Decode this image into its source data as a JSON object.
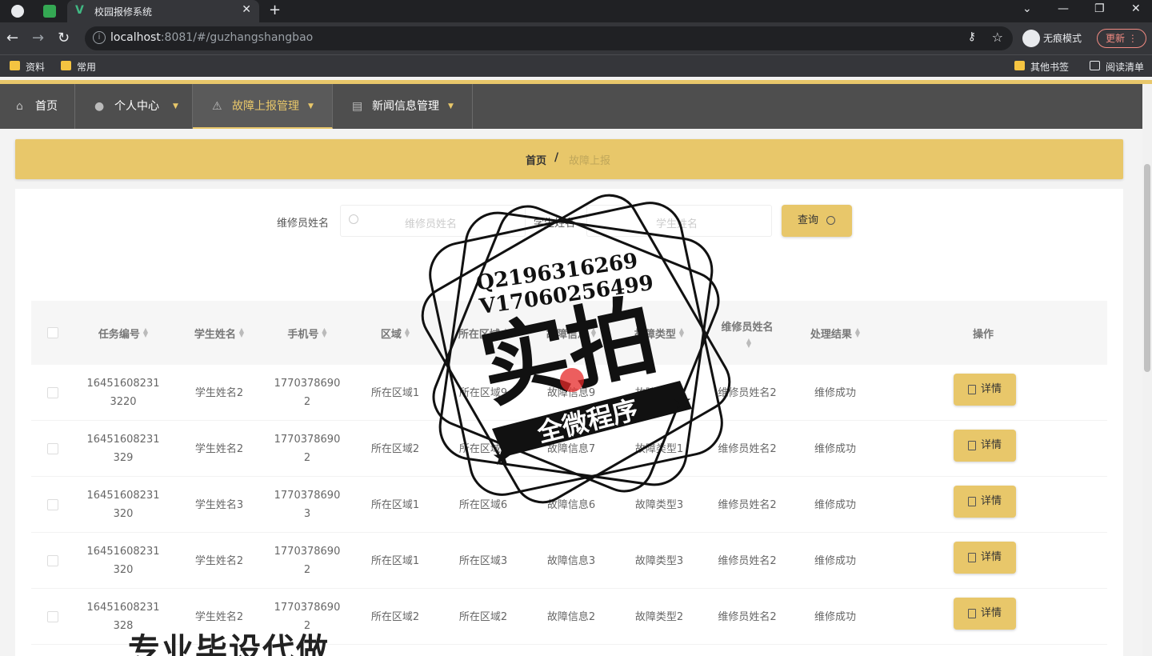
{
  "browser": {
    "tab_title": "校园报修系统",
    "url_host": "localhost",
    "url_rest": ":8081/#/guzhangshangbao",
    "incognito_label": "无痕模式",
    "update_label": "更新",
    "bookmarks": [
      "资料",
      "常用"
    ],
    "bookmarks_right": [
      "其他书签",
      "阅读清单"
    ]
  },
  "nav": {
    "items": [
      {
        "label": "首页",
        "icon": "home-icon"
      },
      {
        "label": "个人中心",
        "icon": "user-icon"
      },
      {
        "label": "故障上报管理",
        "icon": "alert-icon"
      },
      {
        "label": "新闻信息管理",
        "icon": "news-icon"
      }
    ],
    "active_index": 2
  },
  "breadcrumb": {
    "home": "首页",
    "separator": "/",
    "current": "故障上报"
  },
  "search": {
    "label1": "维修员姓名",
    "placeholder1": "维修员姓名",
    "label2": "学生姓名",
    "placeholder2": "学生姓名",
    "button": "查询"
  },
  "table": {
    "headers": [
      "任务编号",
      "学生姓名",
      "手机号",
      "区域",
      "所在区域",
      "故障信息",
      "故障类型",
      "维修员姓名",
      "处理结果",
      "操作"
    ],
    "detail_label": "详情",
    "rows": [
      {
        "id": "16451608231\n3220",
        "student": "学生姓名2",
        "phone": "1770378690\n2",
        "area": "所在区域1",
        "location": "所在区域9",
        "fault": "故障信息9",
        "type": "故障类型2",
        "repairer": "维修员姓名2",
        "result": "维修成功"
      },
      {
        "id": "16451608231\n329",
        "student": "学生姓名2",
        "phone": "1770378690\n2",
        "area": "所在区域2",
        "location": "所在区域7",
        "fault": "故障信息7",
        "type": "故障类型1",
        "repairer": "维修员姓名2",
        "result": "维修成功"
      },
      {
        "id": "16451608231\n320",
        "student": "学生姓名3",
        "phone": "1770378690\n3",
        "area": "所在区域1",
        "location": "所在区域6",
        "fault": "故障信息6",
        "type": "故障类型3",
        "repairer": "维修员姓名2",
        "result": "维修成功"
      },
      {
        "id": "16451608231\n320",
        "student": "学生姓名2",
        "phone": "1770378690\n2",
        "area": "所在区域1",
        "location": "所在区域3",
        "fault": "故障信息3",
        "type": "故障类型3",
        "repairer": "维修员姓名2",
        "result": "维修成功"
      },
      {
        "id": "16451608231\n328",
        "student": "学生姓名2",
        "phone": "1770378690\n2",
        "area": "所在区域2",
        "location": "所在区域2",
        "fault": "故障信息2",
        "type": "故障类型2",
        "repairer": "维修员姓名2",
        "result": "维修成功"
      }
    ]
  },
  "watermark": {
    "line1": "Q2196316269",
    "line2": "V17060256499",
    "big": "实拍",
    "ribbon": "全微程序",
    "bottom": "专业毕设代做"
  },
  "colors": {
    "accent": "#e8c76a",
    "nav_bg": "#4e4e4e"
  }
}
